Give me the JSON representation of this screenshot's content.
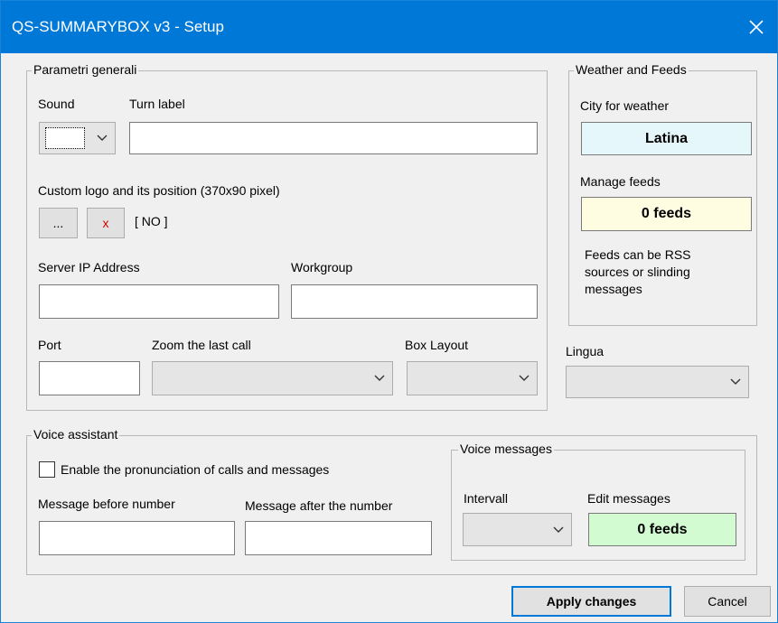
{
  "window": {
    "title": "QS-SUMMARYBOX v3 - Setup",
    "close_icon": "close-icon"
  },
  "general": {
    "legend": "Parametri generali",
    "sound_label": "Sound",
    "turn_label": "Turn label",
    "turn_value": "",
    "logo_label": "Custom logo and its position (370x90 pixel)",
    "browse_button": "...",
    "clear_button": "x",
    "logo_status": "[ NO ]",
    "server_ip_label": "Server IP Address",
    "server_ip_value": "",
    "workgroup_label": "Workgroup",
    "workgroup_value": "",
    "port_label": "Port",
    "port_value": "",
    "zoom_label": "Zoom the last call",
    "zoom_value": "",
    "box_layout_label": "Box Layout",
    "box_layout_value": ""
  },
  "weather": {
    "legend": "Weather and Feeds",
    "city_label": "City for weather",
    "city_value": "Latina",
    "city_color": "#e6f7fb",
    "feeds_label": "Manage feeds",
    "feeds_value": "0 feeds",
    "feeds_color": "#fffde1",
    "feeds_note": "Feeds can be RSS sources or slinding messages"
  },
  "lingua": {
    "label": "Lingua",
    "value": ""
  },
  "voice": {
    "legend": "Voice assistant",
    "enable_label": "Enable the pronunciation of calls and messages",
    "enabled": false,
    "before_label": "Message before number",
    "before_value": "",
    "after_label": "Message after the number",
    "after_value": "",
    "messages": {
      "legend": "Voice messages",
      "interval_label": "Intervall",
      "interval_value": "",
      "edit_label": "Edit messages",
      "edit_value": "0 feeds",
      "edit_color": "#d2fbd2"
    }
  },
  "footer": {
    "apply_button": "Apply changes",
    "cancel_button": "Cancel"
  }
}
